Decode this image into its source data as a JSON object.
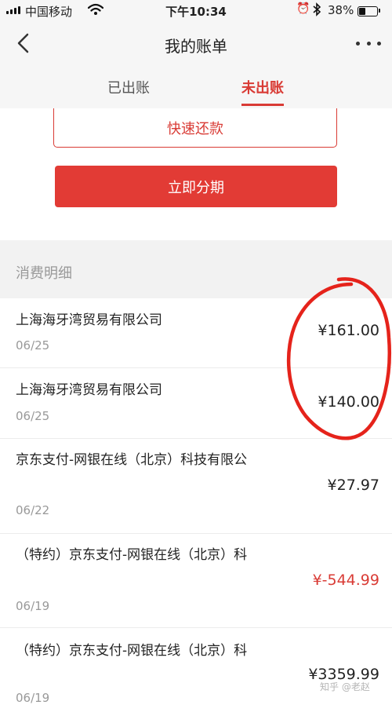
{
  "status_bar": {
    "carrier": "中国移动",
    "time": "下午10:34",
    "battery_percent": "38%",
    "battery_level": 0.38,
    "icons": [
      "signal-icon",
      "wifi-icon",
      "alarm-icon",
      "bluetooth-icon",
      "battery-icon"
    ]
  },
  "nav": {
    "title": "我的账单",
    "back_icon": "chevron-left-icon",
    "more_icon": "more-dots-icon"
  },
  "tabs": [
    {
      "label": "已出账",
      "active": false
    },
    {
      "label": "未出账",
      "active": true
    }
  ],
  "actions": {
    "quick_repay_label": "快速还款",
    "installment_label": "立即分期"
  },
  "section": {
    "title": "消费明细"
  },
  "transactions": [
    {
      "merchant": "上海海牙湾贸易有限公司",
      "date": "06/25",
      "amount": "¥161.00"
    },
    {
      "merchant": "上海海牙湾贸易有限公司",
      "date": "06/25",
      "amount": "¥140.00"
    },
    {
      "merchant": "京东支付-网银在线（北京）科技有限公",
      "date": "06/22",
      "amount": "¥27.97"
    },
    {
      "merchant": "（特约）京东支付-网银在线（北京）科",
      "date": "06/19",
      "amount": "¥-544.99"
    },
    {
      "merchant": "（特约）京东支付-网银在线（北京）科",
      "date": "06/19",
      "amount": "¥3359.99"
    }
  ],
  "colors": {
    "accent": "#e23b35",
    "annotation": "#e5231b",
    "refund_amount": "#d93b35"
  },
  "watermark": "知乎 @老赵"
}
